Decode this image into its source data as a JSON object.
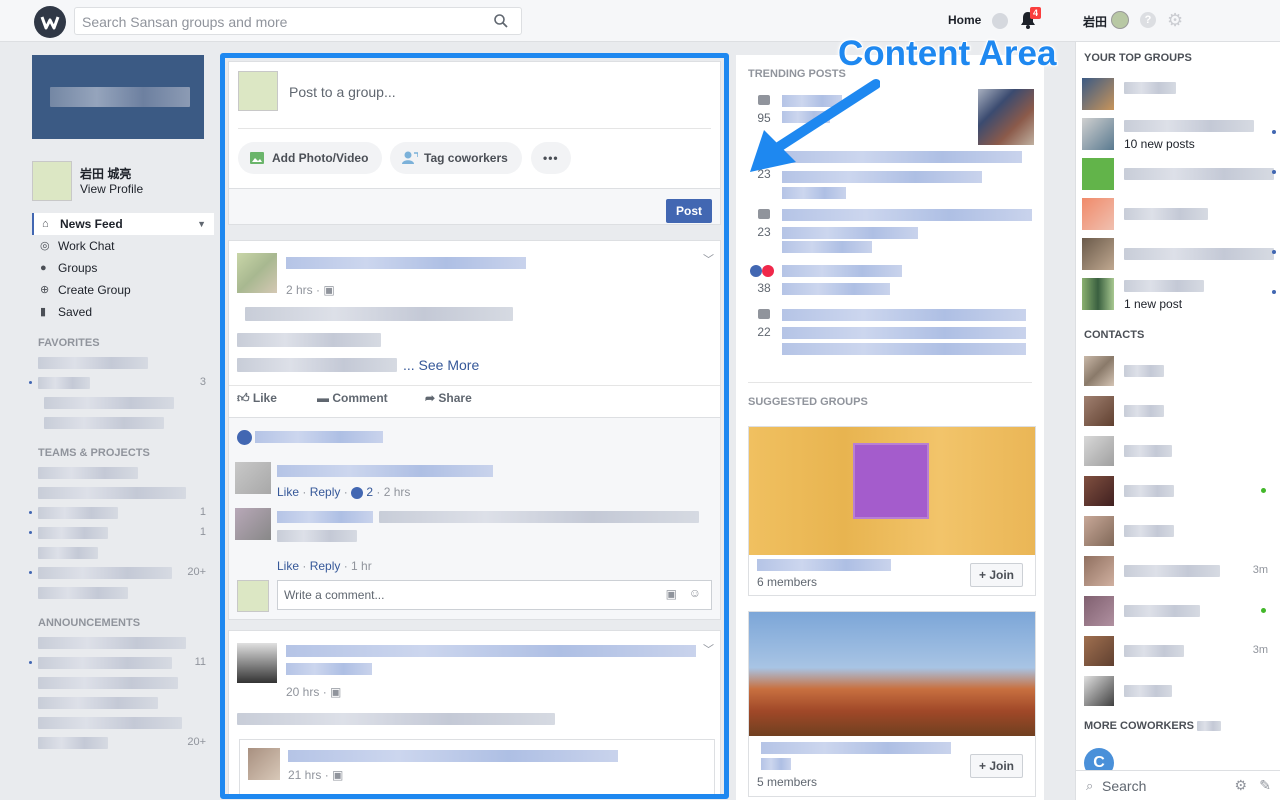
{
  "topbar": {
    "search_placeholder": "Search Sansan groups and more",
    "home": "Home",
    "notif_count": "4",
    "user_name": "岩田"
  },
  "leftnav": {
    "profile_name": "岩田 城亮",
    "view_profile": "View Profile",
    "items": [
      {
        "label": "News Feed",
        "icon": "news-feed-icon"
      },
      {
        "label": "Work Chat",
        "icon": "work-chat-icon"
      },
      {
        "label": "Groups",
        "icon": "groups-icon"
      },
      {
        "label": "Create Group",
        "icon": "create-group-icon"
      },
      {
        "label": "Saved",
        "icon": "saved-icon"
      }
    ],
    "favorites_title": "FAVORITES",
    "favorites_counts": [
      "3"
    ],
    "teams_title": "TEAMS & PROJECTS",
    "teams_counts": [
      "1",
      "1",
      "20+"
    ],
    "announce_title": "ANNOUNCEMENTS",
    "announce_counts": [
      "11",
      "20+"
    ]
  },
  "composer": {
    "placeholder": "Post to a group...",
    "add_photo": "Add Photo/Video",
    "tag": "Tag coworkers",
    "more": "•••",
    "post": "Post"
  },
  "post1": {
    "time": "2 hrs",
    "see_more": "... See More",
    "like": "Like",
    "comment": "Comment",
    "share": "Share",
    "c1_like": "Like",
    "c1_reply": "Reply",
    "c1_likes": "2",
    "c1_time": "2 hrs",
    "c2_like": "Like",
    "c2_reply": "Reply",
    "c2_time": "1 hr",
    "write_comment": "Write a comment..."
  },
  "post2": {
    "time": "20 hrs",
    "shared_time": "21 hrs"
  },
  "rightcol": {
    "trending_title": "TRENDING POSTS",
    "trending_counts": [
      "95",
      "23",
      "23",
      "38",
      "22"
    ],
    "suggested_title": "SUGGESTED GROUPS",
    "g1_members": "6 members",
    "g2_members": "5 members",
    "join": "Join"
  },
  "farright": {
    "top_groups_title": "YOUR TOP GROUPS",
    "g2_sub": "10 new posts",
    "g6_sub": "1 new post",
    "contacts_title": "CONTACTS",
    "contact_status": [
      "3m",
      "3m"
    ],
    "more_title": "MORE COWORKERS",
    "coworker_initial": "C",
    "search": "Search"
  },
  "annotation": "Content Area",
  "colors": {
    "accent": "#4267b2",
    "highlight": "#1e88f0"
  }
}
